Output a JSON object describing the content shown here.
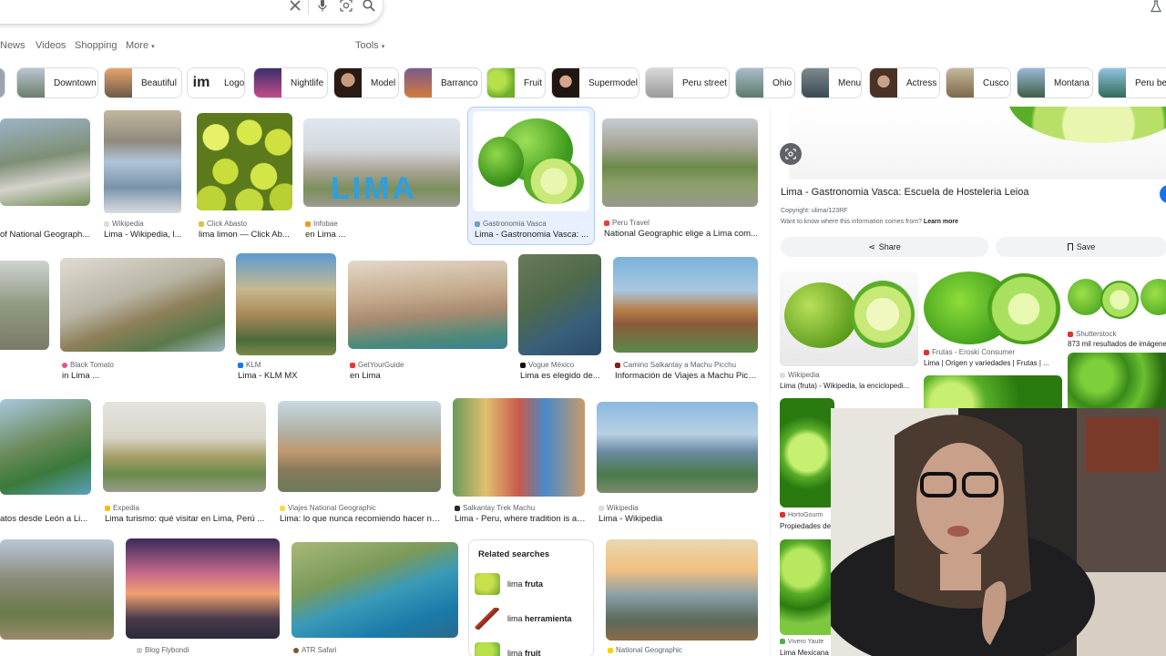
{
  "search": {
    "clear_icon": "close-icon",
    "voice_icon": "mic-icon",
    "lens_icon": "lens-icon",
    "search_icon": "search-icon"
  },
  "tabs": [
    {
      "label": "News"
    },
    {
      "label": "Videos"
    },
    {
      "label": "Shopping"
    },
    {
      "label": "More"
    },
    {
      "label": "Tools"
    }
  ],
  "chips": [
    {
      "label": "Downtown"
    },
    {
      "label": "Beautiful"
    },
    {
      "label": "Logo"
    },
    {
      "label": "Nightlife"
    },
    {
      "label": "Model"
    },
    {
      "label": "Barranco"
    },
    {
      "label": "Fruit"
    },
    {
      "label": "Supermodel"
    },
    {
      "label": "Peru street"
    },
    {
      "label": "Ohio"
    },
    {
      "label": "Menu"
    },
    {
      "label": "Actress"
    },
    {
      "label": "Cusco"
    },
    {
      "label": "Montana"
    },
    {
      "label": "Peru bea"
    }
  ],
  "results": [
    {
      "source": "",
      "title": "of National Geograph..."
    },
    {
      "source": "Wikipedia",
      "title": "Lima - Wikipedia, l..."
    },
    {
      "source": "Click Abasto",
      "title": "lima limon — Click Ab..."
    },
    {
      "source": "Infobae",
      "title": "en Lima ..."
    },
    {
      "source": "Gastronomia Vasca",
      "title": "Lima - Gastronomia Vasca: ..."
    },
    {
      "source": "Peru Travel",
      "title": "National Geographic elige a Lima com..."
    },
    {
      "source": "Black Tomato",
      "title": "in Lima ..."
    },
    {
      "source": "KLM",
      "title": "Lima - KLM MX"
    },
    {
      "source": "GetYourGuide",
      "title": "en Lima"
    },
    {
      "source": "Vogue México",
      "title": "Lima es elegido de..."
    },
    {
      "source": "Camino Salkantay a Machu Picchu",
      "title": "Información de Viajes a Machu Picc..."
    },
    {
      "source": "",
      "title": "atos desde León a Li..."
    },
    {
      "source": "Expedia",
      "title": "Lima turismo: qué visitar en Lima, Perú ..."
    },
    {
      "source": "Viajes National Geographic",
      "title": "Lima: lo que nunca recomiendo hacer ni ..."
    },
    {
      "source": "Salkantay Trek Machu",
      "title": "Lima - Peru, where tradition is a ..."
    },
    {
      "source": "Wikipedia",
      "title": "Lima - Wikipedia"
    },
    {
      "source": "Blog Flybondi",
      "title": ""
    },
    {
      "source": "ATR Safari",
      "title": ""
    },
    {
      "source": "National Geographic",
      "title": ""
    }
  ],
  "related": {
    "heading": "Related searches",
    "items": [
      {
        "prefix": "lima ",
        "bold": "fruta"
      },
      {
        "prefix": "lima ",
        "bold": "herramienta"
      },
      {
        "prefix": "lima ",
        "bold": "fruit"
      }
    ]
  },
  "panel": {
    "title": "Lima - Gastronomia Vasca: Escuela de Hosteleria Leioa",
    "copyright": "Copyright: ulima/123RF",
    "info_text": "Want to know where this information comes from?",
    "learn_more": "Learn more",
    "share_label": "Share",
    "save_label": "Save",
    "similar": [
      {
        "source": "Wikipedia",
        "title": "Lima (fruta) - Wikipedia, la enciclopedi..."
      },
      {
        "source": "Frutas - Eroski Consumer",
        "title": "Lima | Origen y variedades | Frutas | ..."
      },
      {
        "source": "Shutterstock",
        "title": "873 mil resultados de imágene"
      },
      {
        "source": "HortoGourm",
        "title": "Propiedades de"
      },
      {
        "source": "Vivero Yaute",
        "title": "Lima Mexicana"
      }
    ]
  },
  "colors": {
    "accent": "#1a73e8",
    "lime": "#8dc63f",
    "selected_bg": "#e8f0fe"
  }
}
